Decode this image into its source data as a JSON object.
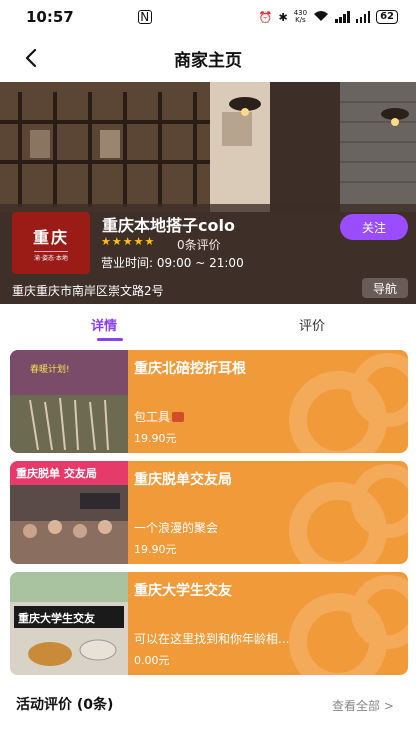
{
  "status_bar": {
    "time": "10:57",
    "net_speed_value": "430",
    "net_speed_unit": "K/s",
    "battery": "62"
  },
  "header": {
    "title": "商家主页"
  },
  "shop": {
    "logo_text": "重庆",
    "logo_sub": "渝·姿态·本地",
    "name": "重庆本地搭子colo",
    "rating_stars": 5,
    "stars_text": "★★★★★",
    "review_count": "0条评价",
    "hours": "营业时间: 09:00 ~ 21:00",
    "address": "重庆重庆市南岸区崇文路2号",
    "follow_label": "关注",
    "navigate_label": "导航"
  },
  "tabs": [
    {
      "label": "详情",
      "active": true
    },
    {
      "label": "评价",
      "active": false
    }
  ],
  "products": [
    {
      "title": "重庆北碚挖折耳根",
      "desc": "包工具",
      "price": "19.90元",
      "thumb_text": "春暖计划!"
    },
    {
      "title": "重庆脱单交友局",
      "desc": "一个浪漫的聚会",
      "price": "19.90元",
      "thumb_text": "重庆脱单 交友局"
    },
    {
      "title": "重庆大学生交友",
      "desc": "可以在这里找到和你年龄相...",
      "price": "0.00元",
      "thumb_text": "重庆大学生交友"
    }
  ],
  "reviews_section": {
    "title": "活动评价 (0条)",
    "view_all": "查看全部 >"
  },
  "colors": {
    "accent": "#8a3ffc",
    "follow": "#9a4dff",
    "card": "#f09a3a",
    "stars": "#ffc107"
  }
}
